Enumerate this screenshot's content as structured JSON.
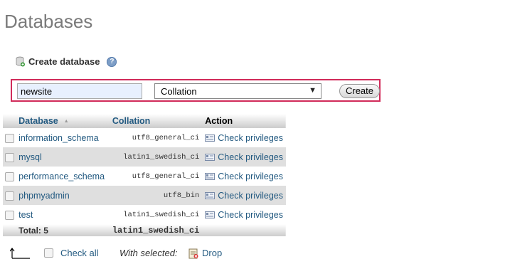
{
  "page": {
    "title": "Databases"
  },
  "create": {
    "heading": "Create database",
    "name_value": "newsite",
    "collation_value": "Collation",
    "create_label": "Create"
  },
  "table": {
    "headers": {
      "database": "Database",
      "collation": "Collation",
      "action": "Action"
    },
    "rows": [
      {
        "name": "information_schema",
        "collation": "utf8_general_ci",
        "action": "Check privileges"
      },
      {
        "name": "mysql",
        "collation": "latin1_swedish_ci",
        "action": "Check privileges"
      },
      {
        "name": "performance_schema",
        "collation": "utf8_general_ci",
        "action": "Check privileges"
      },
      {
        "name": "phpmyadmin",
        "collation": "utf8_bin",
        "action": "Check privileges"
      },
      {
        "name": "test",
        "collation": "latin1_swedish_ci",
        "action": "Check privileges"
      }
    ],
    "total_label": "Total: 5",
    "total_collation": "latin1_swedish_ci"
  },
  "bottom": {
    "check_all": "Check all",
    "with_selected": "With selected:",
    "drop": "Drop"
  },
  "colors": {
    "accent": "#235a81",
    "highlight": "#d12b5a"
  }
}
